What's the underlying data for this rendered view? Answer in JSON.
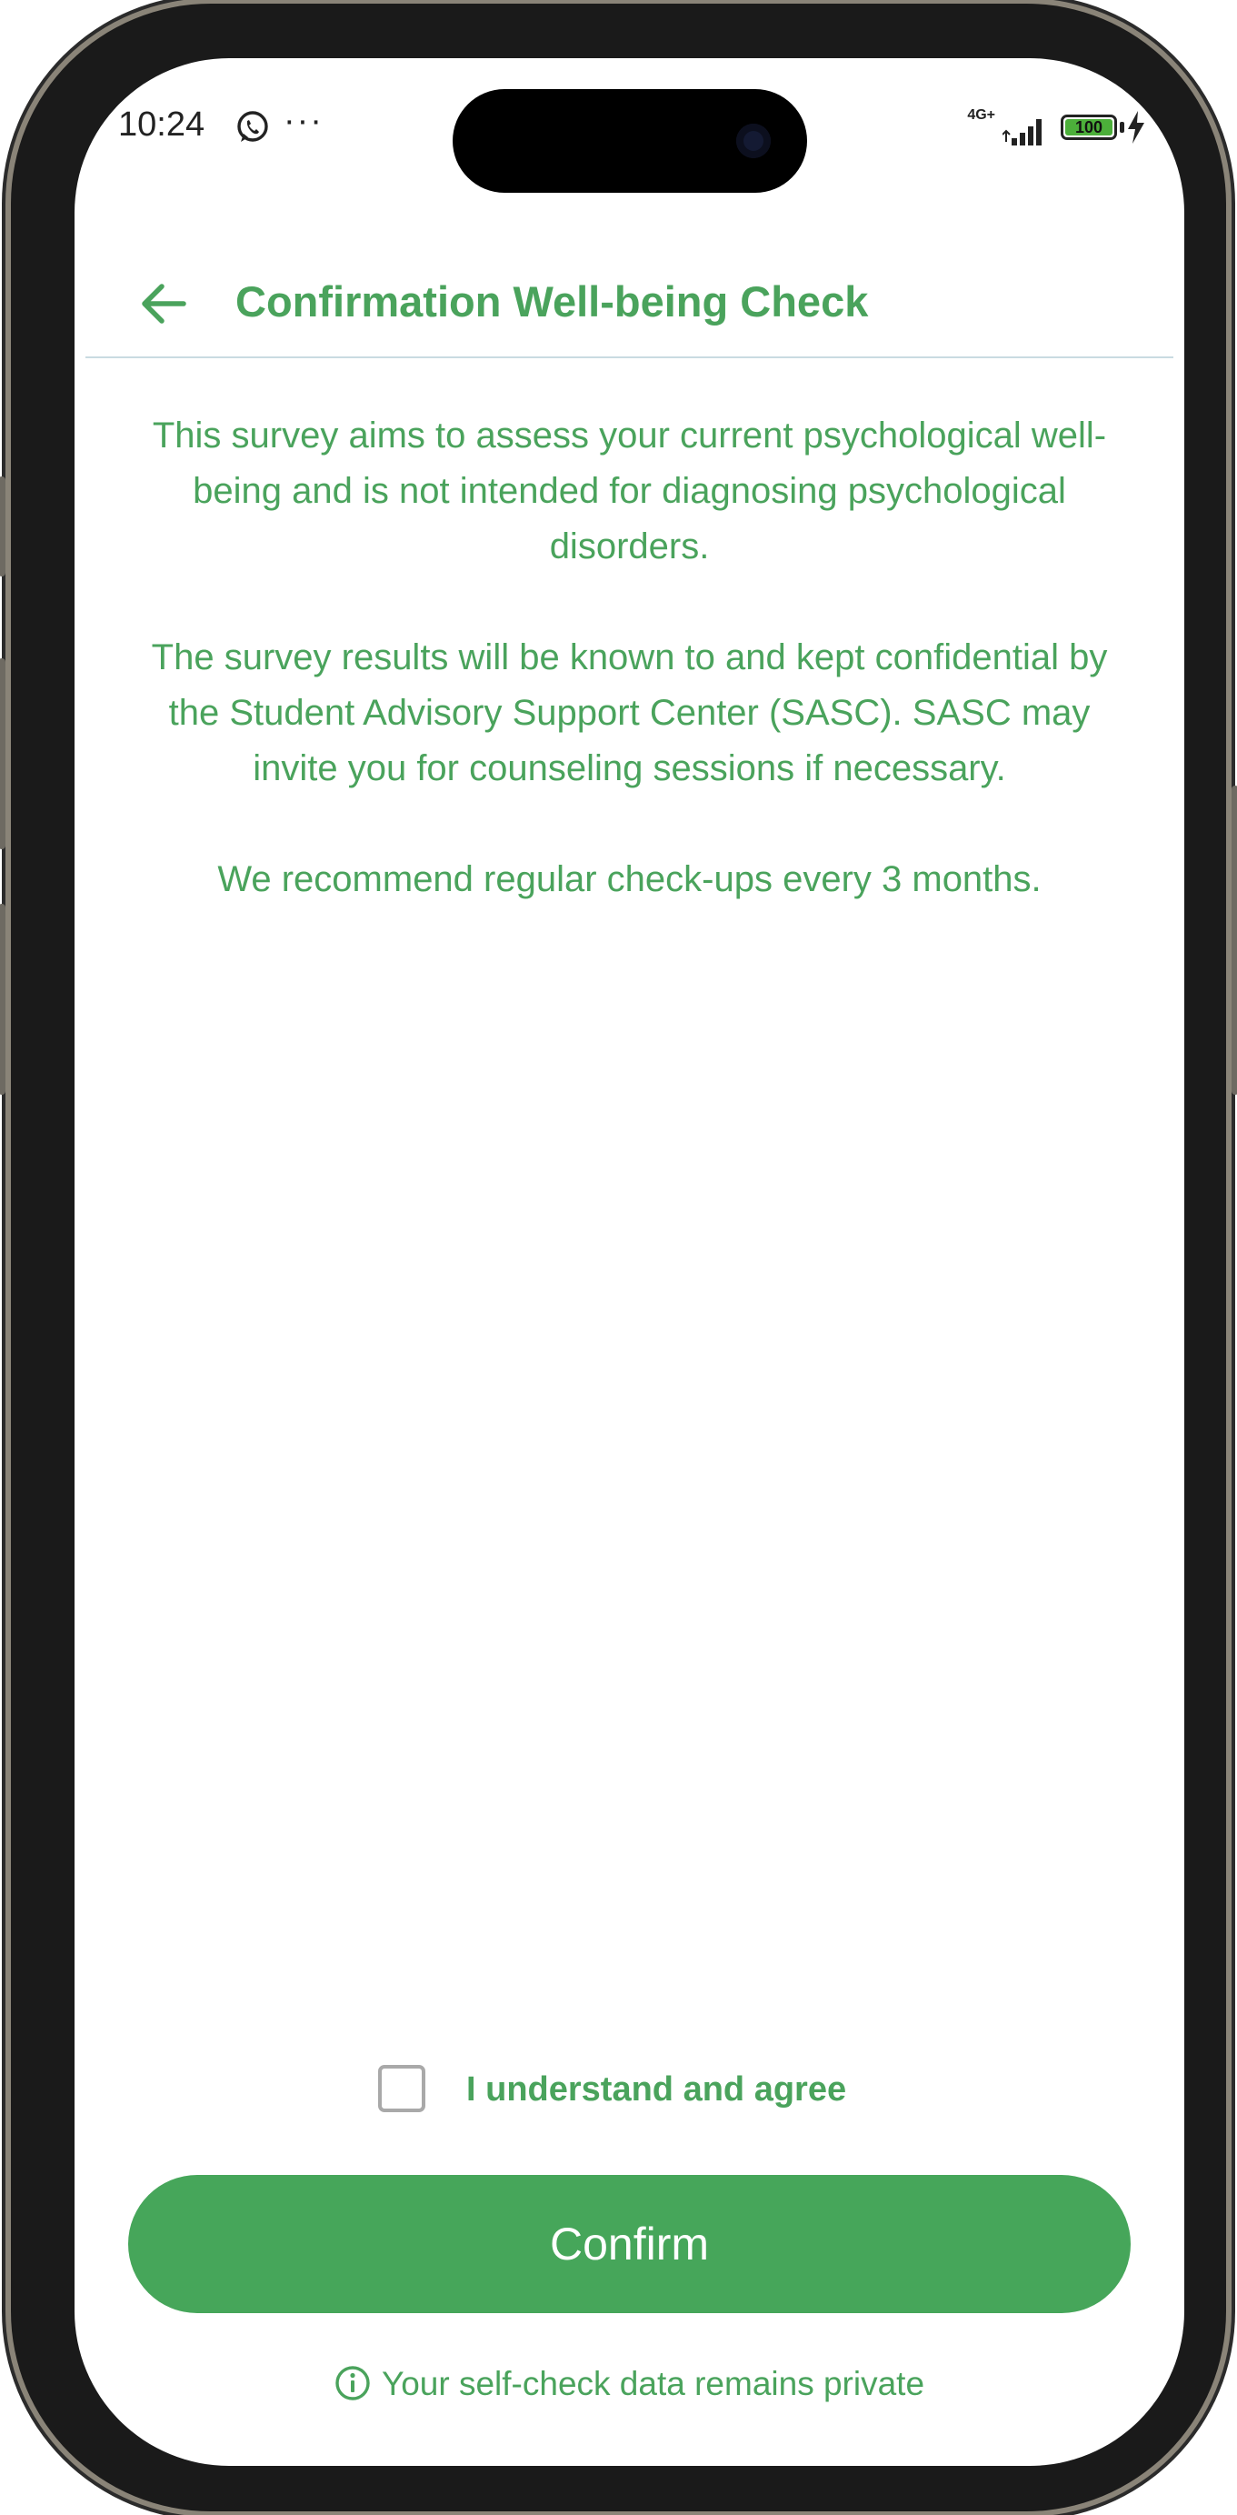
{
  "status_bar": {
    "time": "10:24",
    "more": "···",
    "network": "4G+",
    "battery_level": "100",
    "icons": [
      "whatsapp-icon",
      "signal-icon",
      "battery-icon",
      "charging-icon"
    ]
  },
  "header": {
    "title": "Confirmation Well-being Check",
    "back_icon": "back-arrow-icon"
  },
  "body": {
    "paragraph_1": "This survey aims to assess your current psychological well-being and is not intended for diagnosing psychological disorders.",
    "paragraph_2": "The survey results will be known to and kept confidential by the Student Advisory Support Center (SASC). SASC may invite you for counseling sessions if necessary.",
    "paragraph_3": "We recommend regular check-ups every 3 months."
  },
  "agreement": {
    "checked": false,
    "label": "I understand and agree"
  },
  "confirm_button": {
    "label": "Confirm"
  },
  "footer": {
    "privacy_note": "Your self-check data remains private",
    "icon": "info-icon"
  },
  "colors": {
    "accent": "#4aa35c",
    "button": "#46a65a",
    "divider": "#c9dbe1",
    "checkbox_border": "#a9a9a9"
  }
}
